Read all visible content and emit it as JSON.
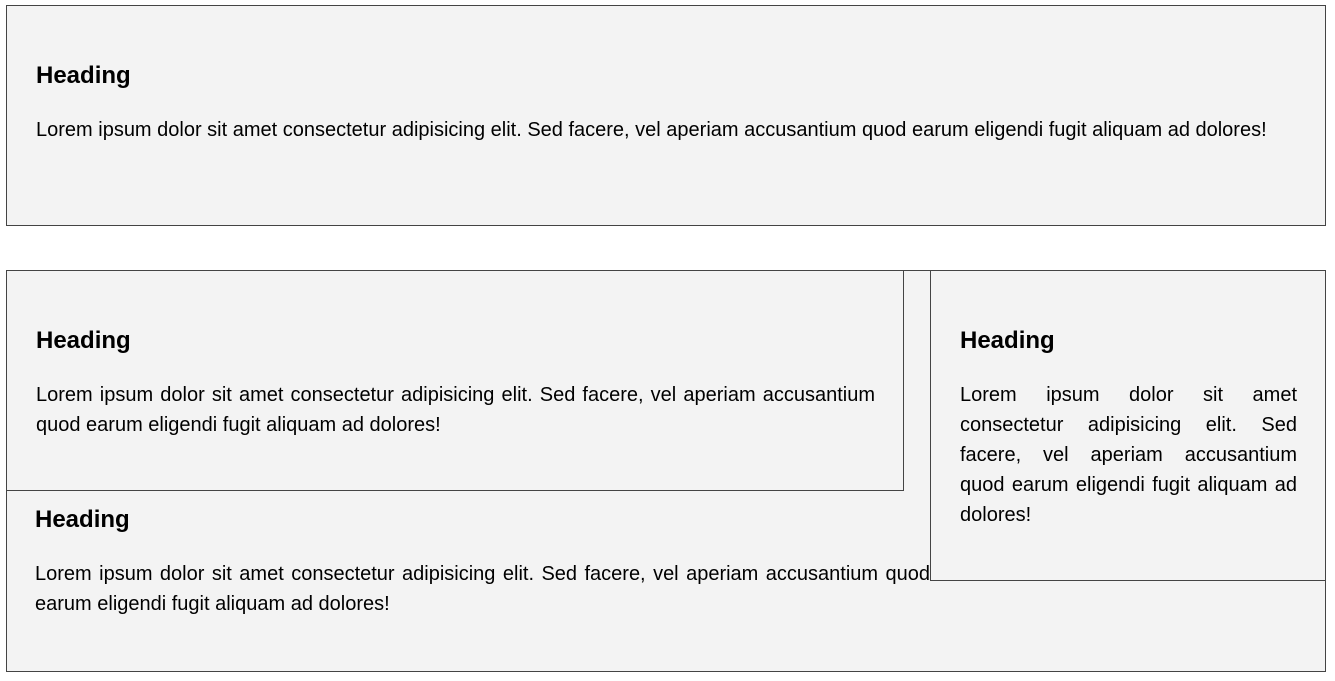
{
  "cards": [
    {
      "heading": "Heading",
      "body": "Lorem ipsum dolor sit amet consectetur adipisicing elit. Sed facere, vel aperiam accusantium quod earum eligendi fugit aliquam ad dolores!"
    },
    {
      "heading": "Heading",
      "body": "Lorem ipsum dolor sit amet consectetur adipisicing elit. Sed facere, vel aperiam accusantium quod earum eligendi fugit aliquam ad dolores!"
    },
    {
      "heading": "Heading",
      "body": "Lorem ipsum dolor sit amet consectetur adipisicing elit. Sed facere, vel aperiam accusantium quod earum eligendi fugit aliquam ad dolores!"
    },
    {
      "heading": "Heading",
      "body": "Lorem ipsum dolor sit amet consectetur adipisicing elit. Sed facere, vel aperiam accusantium quod earum eligendi fugit aliquam ad dolores!"
    }
  ]
}
